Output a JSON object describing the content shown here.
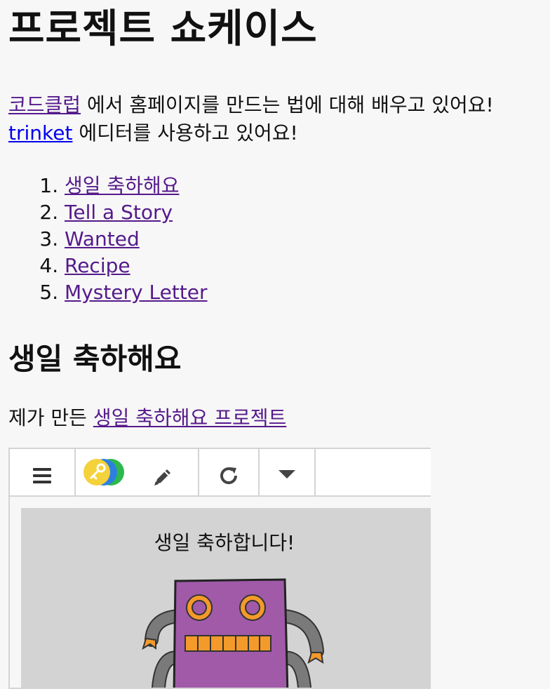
{
  "page": {
    "title": "프로젝트 쇼케이스",
    "intro": {
      "line1_link": "코드클럽",
      "line1_text": " 에서 홈페이지를 만드는 법에 대해 배우고 있어요!",
      "line2_link": "trinket",
      "line2_text": " 에디터를 사용하고 있어요!"
    },
    "projects": [
      {
        "label": "생일 축하해요"
      },
      {
        "label": "Tell a Story"
      },
      {
        "label": "Wanted"
      },
      {
        "label": "Recipe"
      },
      {
        "label": "Mystery Letter"
      }
    ],
    "section": {
      "heading": "생일 축하해요",
      "desc_text": "제가 만든 ",
      "desc_link": "생일 축하해요 프로젝트"
    }
  },
  "trinket": {
    "toolbar": {
      "menu_icon": "hamburger-menu-icon",
      "share_icon": "key-share-icon",
      "edit_icon": "pencil-icon",
      "run_icon": "refresh-icon",
      "more_icon": "caret-down-icon"
    },
    "stage": {
      "title": "생일  축하합니다!",
      "background": "#d3d3d3"
    },
    "colors": {
      "robot_body": "#a05aa8",
      "robot_eyes": "#f39a2a",
      "robot_arms": "#7a7a7a"
    }
  }
}
